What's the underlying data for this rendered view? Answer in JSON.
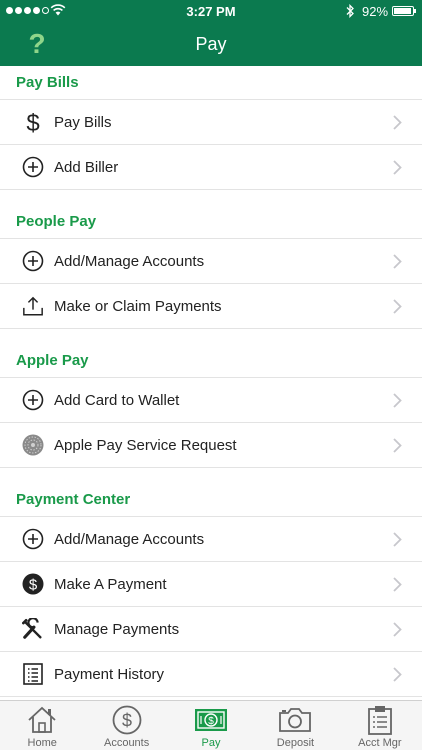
{
  "status_bar": {
    "time": "3:27 PM",
    "battery": "92%",
    "battery_level": 0.92
  },
  "nav": {
    "title": "Pay",
    "help_label": "?"
  },
  "sections": [
    {
      "title": "Pay Bills",
      "items": [
        {
          "label": "Pay Bills",
          "icon": "dollar-icon"
        },
        {
          "label": "Add Biller",
          "icon": "add-circle-icon"
        }
      ]
    },
    {
      "title": "People Pay",
      "items": [
        {
          "label": "Add/Manage Accounts",
          "icon": "add-circle-icon"
        },
        {
          "label": "Make or Claim Payments",
          "icon": "share-upload-icon"
        }
      ]
    },
    {
      "title": "Apple Pay",
      "items": [
        {
          "label": "Add Card to Wallet",
          "icon": "add-circle-icon"
        },
        {
          "label": "Apple Pay Service Request",
          "icon": "apple-pay-icon"
        }
      ]
    },
    {
      "title": "Payment Center",
      "items": [
        {
          "label": "Add/Manage Accounts",
          "icon": "add-circle-icon"
        },
        {
          "label": "Make A Payment",
          "icon": "dollar-circle-icon"
        },
        {
          "label": "Manage Payments",
          "icon": "tools-icon"
        },
        {
          "label": "Payment History",
          "icon": "list-icon"
        }
      ]
    }
  ],
  "tabs": [
    {
      "label": "Home",
      "icon": "home-icon"
    },
    {
      "label": "Accounts",
      "icon": "dollar-coin-icon"
    },
    {
      "label": "Pay",
      "icon": "cash-icon",
      "active": true
    },
    {
      "label": "Deposit",
      "icon": "camera-icon"
    },
    {
      "label": "Acct Mgr",
      "icon": "clipboard-icon"
    }
  ],
  "colors": {
    "brand_green": "#0b7a4f",
    "accent_green": "#1a9a4a",
    "help_green": "#8fd58a"
  }
}
